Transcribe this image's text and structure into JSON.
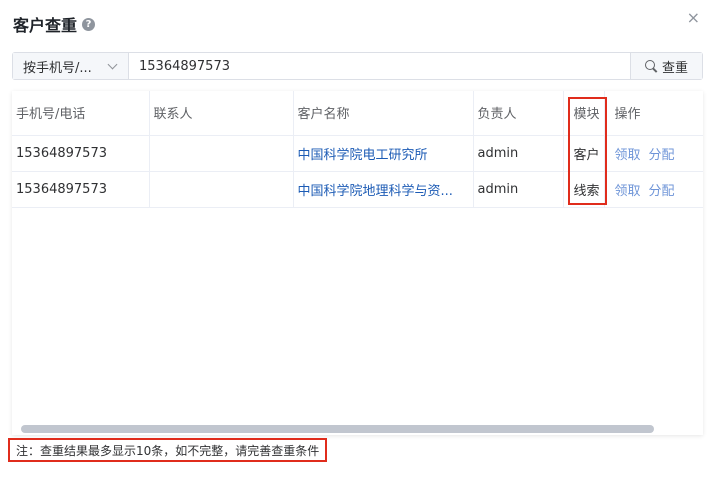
{
  "dialog": {
    "title": "客户查重",
    "help_icon": "question-circle-icon",
    "help_glyph": "?",
    "close_icon": "close-icon",
    "close_glyph": "×"
  },
  "search": {
    "select_value": "按手机号/...",
    "input_value": "15364897573",
    "button_label": "查重",
    "button_icon": "search-icon"
  },
  "table": {
    "columns": [
      "手机号/电话",
      "联系人",
      "客户名称",
      "负责人",
      "模块",
      "操作"
    ],
    "rows": [
      {
        "phone": "15364897573",
        "contact": "",
        "customer": "中国科学院电工研究所",
        "owner": "admin",
        "module": "客户",
        "actions": [
          "领取",
          "分配"
        ]
      },
      {
        "phone": "15364897573",
        "contact": "",
        "customer": "中国科学院地理科学与资...",
        "owner": "admin",
        "module": "线索",
        "actions": [
          "领取",
          "分配"
        ]
      }
    ]
  },
  "note": "注：查重结果最多显示10条，如不完整，请完善查重条件",
  "colors": {
    "link": "#1c5bb5",
    "action": "#6f95d8",
    "highlight": "#e02c1c"
  }
}
